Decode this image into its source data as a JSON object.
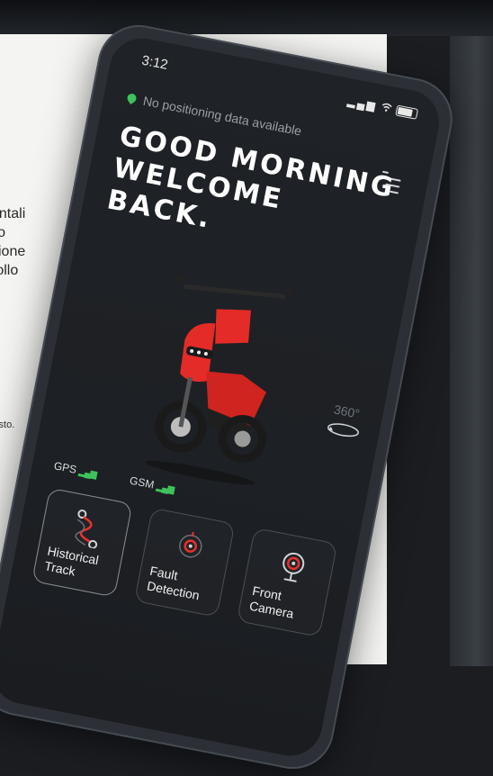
{
  "background": {
    "text_lines": [
      "e",
      "entali",
      "llo",
      "zione",
      "rollo"
    ],
    "note": "uisto."
  },
  "status_bar": {
    "time": "3:12"
  },
  "location": {
    "text": "No positioning data available"
  },
  "greeting": {
    "lines": [
      "GOOD MORNING",
      "WELCOME",
      "BACK."
    ]
  },
  "rotate": {
    "label": "360°"
  },
  "signals": {
    "gps": "GPS",
    "gsm": "GSM"
  },
  "cards": [
    {
      "lines": [
        "Historical",
        "Track"
      ],
      "icon": "route-icon"
    },
    {
      "lines": [
        "Fault",
        "Detection"
      ],
      "icon": "diagnostic-icon"
    },
    {
      "lines": [
        "Front",
        "Camera"
      ],
      "icon": "camera-icon"
    }
  ],
  "colors": {
    "accent_red": "#e8312d",
    "signal_green": "#3ec35a",
    "screen_bg": "#1f2226"
  }
}
